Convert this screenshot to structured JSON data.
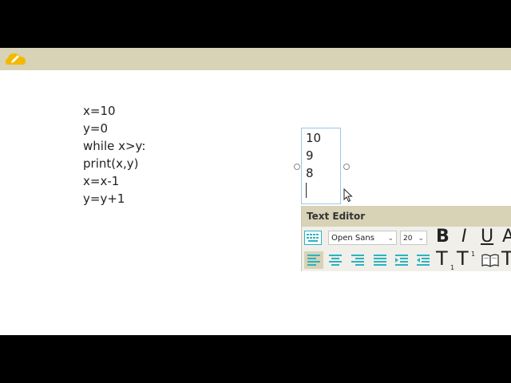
{
  "code": {
    "lines": [
      "x=10",
      "y=0",
      "while x>y:",
      "print(x,y)",
      "x=x-1",
      "y=y+1"
    ]
  },
  "textbox": {
    "lines": [
      "10",
      "9",
      "8"
    ]
  },
  "text_editor": {
    "title": "Text Editor",
    "font_family_value": "Open Sans",
    "font_size_value": "20",
    "bold_label": "B",
    "italic_label": "I",
    "underline_label": "U",
    "fontcolor_label": "A",
    "subscript_label": "T",
    "subscript_mark": "1",
    "superscript_label": "T",
    "superscript_mark": "1",
    "extra_t_label": "T"
  },
  "colors": {
    "topbar": "#d8d2b6",
    "accent_yellow": "#f5b800",
    "accent_teal": "#2bb3c0",
    "textbox_border": "#9cc6e6"
  },
  "icons": [
    "pencil-icon",
    "keyboard-icon",
    "align-left-icon",
    "align-center-icon",
    "align-right-icon",
    "justify-icon",
    "indent-icon",
    "outdent-icon",
    "dictionary-icon",
    "chevron-down-icon"
  ]
}
